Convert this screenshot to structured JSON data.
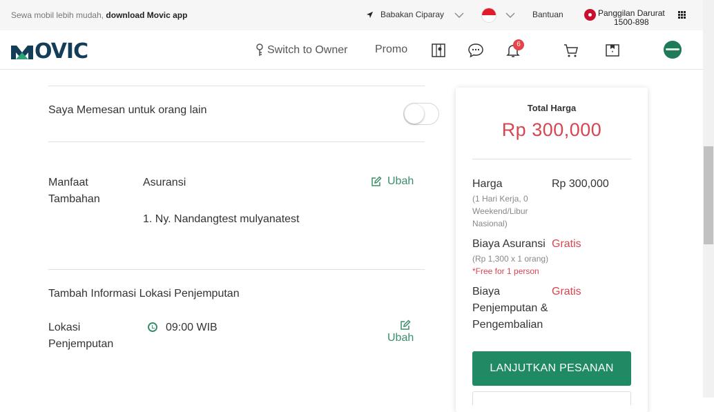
{
  "topbar": {
    "promo_text": "Sewa mobil lebih mudah,",
    "promo_link": "download Movic app",
    "location": "Babakan Ciparay",
    "help": "Bantuan",
    "emergency_line1": "Panggilan Darurat",
    "emergency_line2": "1500-898"
  },
  "header": {
    "logo": "MOVIC",
    "switch_owner": "Switch to Owner",
    "promo": "Promo",
    "notification_count": "6"
  },
  "form": {
    "order_for_other_label": "Saya Memesan untuk orang lain",
    "order_for_other_enabled": false,
    "benefit_label_1": "Manfaat",
    "benefit_label_2": "Tambahan",
    "benefit_type": "Asuransi",
    "benefit_person": "1. Ny. Nandangtest mulyanatest",
    "edit_label": "Ubah",
    "pickup_section_title": "Tambah Informasi Lokasi Penjemputan",
    "pickup_label_1": "Lokasi",
    "pickup_label_2": "Penjemputan",
    "pickup_time": "09:00 WIB"
  },
  "summary": {
    "total_label": "Total Harga",
    "total_value": "Rp 300,000",
    "price_label": "Harga",
    "price_detail_1": "(1 Hari Kerja, 0",
    "price_detail_2": "Weekend/Libur",
    "price_detail_3": "Nasional)",
    "price_value": "Rp 300,000",
    "insurance_label": "Biaya Asuransi",
    "insurance_detail": "(Rp 1,300 x 1 orang)",
    "insurance_note": "*Free for 1 person",
    "insurance_value": "Gratis",
    "pickup_fee_1": "Biaya",
    "pickup_fee_2": "Penjemputan &",
    "pickup_fee_3": "Pengembalian",
    "pickup_fee_value": "Gratis",
    "continue_button": "LANJUTKAN PESANAN"
  },
  "colors": {
    "brand_green": "#1f8a63",
    "accent_red": "#d64550",
    "logo_navy": "#143d58"
  }
}
